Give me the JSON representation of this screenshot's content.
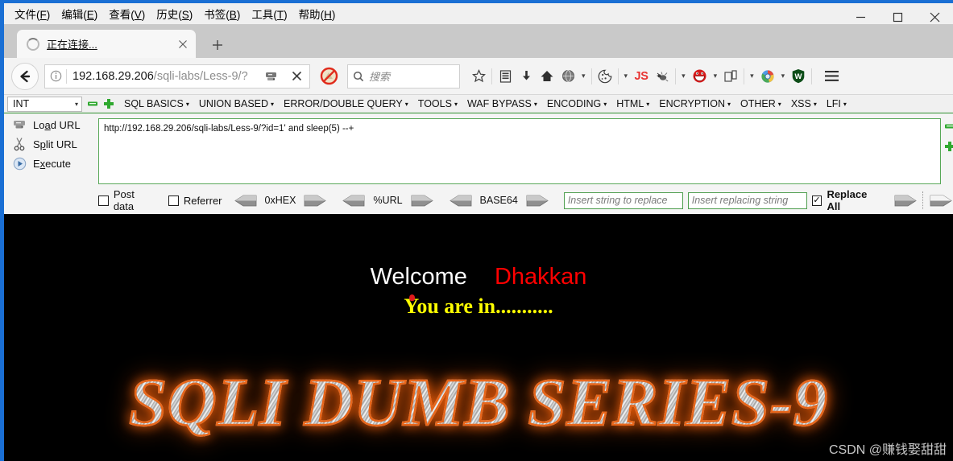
{
  "window": {
    "controls": {
      "minimize": "–",
      "maximize": "☐",
      "close": "✕"
    }
  },
  "menubar": {
    "items": [
      {
        "label": "文件",
        "accel": "F"
      },
      {
        "label": "编辑",
        "accel": "E"
      },
      {
        "label": "查看",
        "accel": "V"
      },
      {
        "label": "历史",
        "accel": "S"
      },
      {
        "label": "书签",
        "accel": "B"
      },
      {
        "label": "工具",
        "accel": "T"
      },
      {
        "label": "帮助",
        "accel": "H"
      }
    ]
  },
  "tabs": {
    "active": {
      "title": "正在连接...",
      "spinner": "loading-spinner",
      "close_icon": "close-icon"
    },
    "new_tab_label": "+"
  },
  "navbar": {
    "back_icon": "back-arrow-icon",
    "identity_icon": "info-circle-icon",
    "url_host": "192.168.29.206",
    "url_path": "/sqli-labs/Less-9/?",
    "reader_icon": "reader-view-icon",
    "stop_icon": "stop-loading-icon",
    "noscript_icon": "noscript-blocked-icon",
    "search_placeholder": "搜索",
    "search_icon": "search-icon",
    "icons": [
      {
        "name": "bookmark-star-icon",
        "glyph": "☆"
      },
      {
        "name": "library-icon",
        "glyph": "Ὅ4"
      },
      {
        "name": "downloads-icon",
        "glyph": "↓"
      },
      {
        "name": "home-icon",
        "glyph": "⌂"
      },
      {
        "name": "globe-icon",
        "glyph": "●"
      },
      {
        "name": "cookie-manager-icon",
        "glyph": "◌"
      },
      {
        "name": "javascript-toggle-icon",
        "glyph": "JS"
      },
      {
        "name": "bug-icon",
        "glyph": "✒"
      },
      {
        "name": "hackbar-icon",
        "glyph": "☺"
      },
      {
        "name": "copy-page-icon",
        "glyph": "❐"
      },
      {
        "name": "browser-globe-icon",
        "glyph": "◔"
      },
      {
        "name": "adblock-shield-icon",
        "glyph": "W"
      },
      {
        "name": "menu-hamburger-icon",
        "glyph": "☰"
      }
    ]
  },
  "hackbar": {
    "type_select": {
      "value": "INT",
      "caret": "▾"
    },
    "minus_button": "minus-button",
    "plus_button": "plus-button",
    "menus": [
      "SQL BASICS",
      "UNION BASED",
      "ERROR/DOUBLE QUERY",
      "TOOLS",
      "WAF BYPASS",
      "ENCODING",
      "HTML",
      "ENCRYPTION",
      "OTHER",
      "XSS",
      "LFI"
    ],
    "caret": "▾",
    "actions": [
      {
        "label_pre": "Lo",
        "accel": "a",
        "label_post": "d URL",
        "icon": "load-url-icon"
      },
      {
        "label_pre": "S",
        "accel": "p",
        "label_post": "lit URL",
        "icon": "split-url-icon"
      },
      {
        "label_pre": "E",
        "accel": "x",
        "label_post": "ecute",
        "icon": "execute-icon"
      }
    ],
    "request_value": "http://192.168.29.206/sqli-labs/Less-9/?id=1' and sleep(5) --+",
    "checkboxes": [
      {
        "label": "Post data",
        "checked": false
      },
      {
        "label": "Referrer",
        "checked": false
      }
    ],
    "encoders": [
      "0xHEX",
      "%URL",
      "BASE64"
    ],
    "replace": {
      "search_placeholder": "Insert string to replace",
      "replace_placeholder": "Insert replacing string",
      "replace_all_label": "Replace All",
      "replace_all_checked": true,
      "check_glyph": "✓"
    }
  },
  "page": {
    "welcome_label": "Welcome",
    "user_label": "Dhakkan",
    "status_label": "You are in...........",
    "banner_title": "SQLI DUMB SERIES-9",
    "watermark": "CSDN @赚钱娶甜甜",
    "colors": {
      "welcome": "#ffffff",
      "user": "#ff0000",
      "status": "#ffff00",
      "banner_glow": "#e8661a",
      "background": "#000000"
    }
  }
}
